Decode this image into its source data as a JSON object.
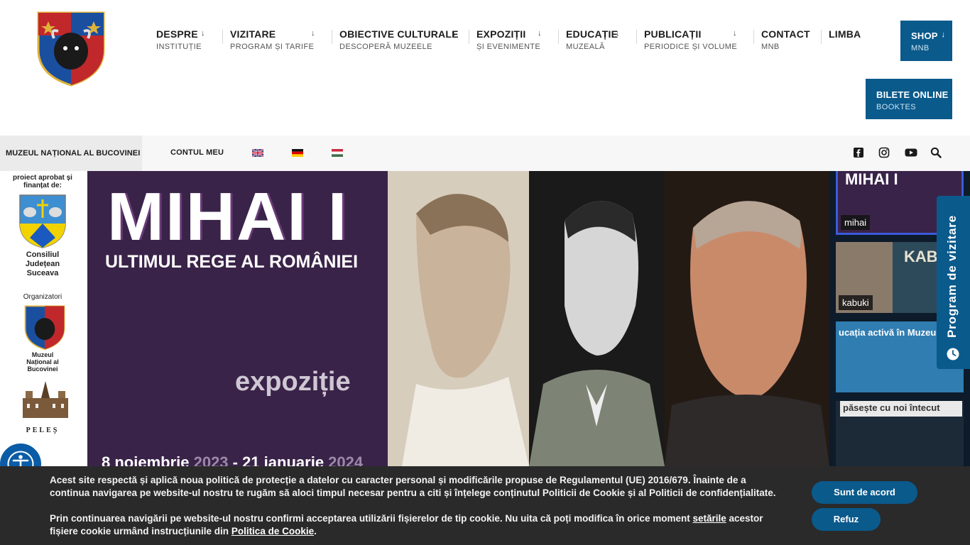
{
  "nav": [
    {
      "title": "DESPRE",
      "sub": "INSTITUȚIE",
      "arrow": "↓"
    },
    {
      "title": "VIZITARE",
      "sub": "PROGRAM ȘI TARIFE",
      "arrow": "↓"
    },
    {
      "title": "OBIECTIVE CULTURALE",
      "sub": "DESCOPERĂ MUZEELE",
      "arrow": "↓"
    },
    {
      "title": "EXPOZIȚII",
      "sub": "ȘI EVENIMENTE",
      "arrow": "↓"
    },
    {
      "title": "EDUCAȚIE",
      "sub": "MUZEALĂ",
      "arrow": "↓"
    },
    {
      "title": "PUBLICAȚII",
      "sub": "PERIODICE ȘI VOLUME",
      "arrow": "↓"
    },
    {
      "title": "CONTACT",
      "sub": "MNB",
      "arrow": ""
    },
    {
      "title": "LIMBA",
      "sub": "",
      "arrow": "↓"
    }
  ],
  "shop": {
    "title": "SHOP",
    "sub": "MNB",
    "arrow": "↓"
  },
  "tickets": {
    "title": "BILETE ONLINE",
    "sub": "BOOKTES"
  },
  "bar": {
    "title": "MUZEUL NAȚIONAL AL BUCOVINEI",
    "account": "CONTUL MEU",
    "flags": [
      "english-flag",
      "german-flag",
      "hungarian-flag"
    ],
    "social": [
      "facebook-icon",
      "instagram-icon",
      "youtube-icon",
      "search-icon"
    ]
  },
  "sidebar_left": {
    "approved": "proiect aprobat și finanțat de:",
    "council": "Consiliul Județean Suceava",
    "organizers": "Organizatori",
    "museum": "Muzeul Național al Bucovinei",
    "peles": "PELEȘ"
  },
  "banner": {
    "title": "MIHAI I",
    "subtitle": "ULTIMUL REGE AL ROMÂNIEI",
    "label": "expoziție",
    "date_start": "8 noiembrie ",
    "year_start": "2023",
    "date_sep": " - 21 ianuarie ",
    "year_end": "2024"
  },
  "thumbs": [
    {
      "caption": "mihai",
      "active": true
    },
    {
      "caption": "kabuki",
      "active": false
    },
    {
      "caption": "",
      "active": false,
      "text": "ucația activă în Muzeu - o cale"
    },
    {
      "caption": "",
      "active": false,
      "text": "păsește cu noi întecut"
    }
  ],
  "program_tab": "Program de vizitare",
  "cookie": {
    "p1": "Acest site respectă și aplică noua politică de protecție a datelor cu caracter personal și modificările propuse de Regulamentul (UE) 2016/679. Înainte de a continua navigarea pe website-ul nostru te rugăm să aloci timpul necesar pentru a citi și înțelege conținutul Politicii de Cookie și al Politicii de confidențialitate.",
    "p2_a": "Prin continuarea navigării pe website-ul nostru confirmi acceptarea utilizării fișierelor de tip cookie. Nu uita că poți modifica în orice moment ",
    "p2_link1": "setările",
    "p2_b": " acestor fișiere cookie urmând instrucțiunile din ",
    "p2_link2": "Politica de Cookie",
    "p2_c": ".",
    "accept": "Sunt de acord",
    "refuse": "Refuz"
  },
  "colors": {
    "brand_blue": "#0a5a8c",
    "banner_purple": "#3a2348",
    "cookie_bg": "#2a2a2a"
  }
}
